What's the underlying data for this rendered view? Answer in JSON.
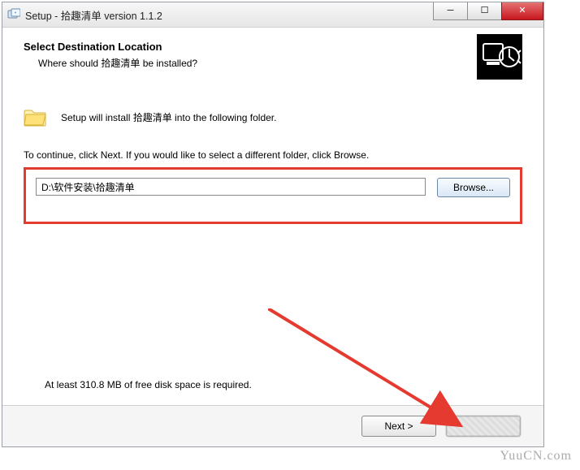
{
  "window": {
    "title": "Setup - 拾趣清单 version 1.1.2"
  },
  "wizard": {
    "heading": "Select Destination Location",
    "subheading": "Where should 拾趣清单 be installed?",
    "install_intro": "Setup will install 拾趣清单 into the following folder.",
    "continue_hint": "To continue, click Next. If you would like to select a different folder, click Browse.",
    "install_path": "D:\\软件安装\\拾趣清单",
    "browse_label": "Browse...",
    "disk_space": "At least 310.8 MB of free disk space is required.",
    "next_label": "Next >"
  },
  "watermark": "YuuCN.com"
}
